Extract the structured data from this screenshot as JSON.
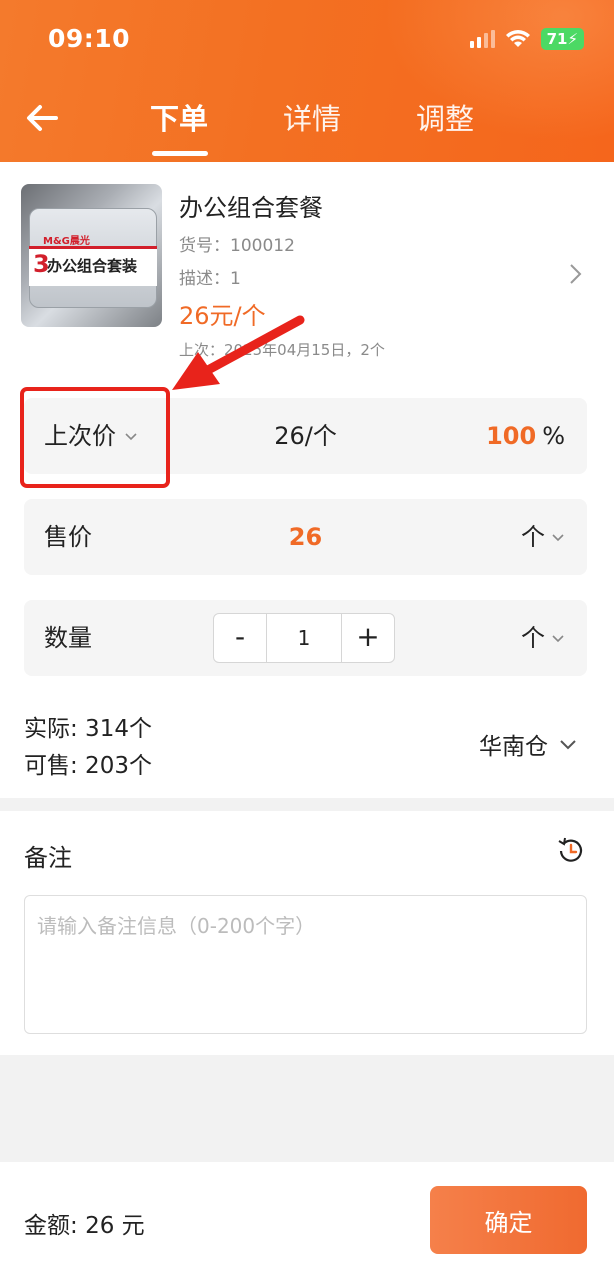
{
  "status_bar": {
    "time": "09:10",
    "battery": "71"
  },
  "header": {
    "tabs": [
      {
        "label": "下单",
        "active": true
      },
      {
        "label": "详情",
        "active": false
      },
      {
        "label": "调整",
        "active": false
      }
    ]
  },
  "product": {
    "image_text": {
      "number": "3",
      "name": "办公组合套装",
      "brand": "M&G晨光"
    },
    "title": "办公组合套餐",
    "item_no": "货号：100012",
    "description": "描述：1",
    "price": "26元/个",
    "last_order": "上次：2025年04月15日，2个"
  },
  "price_row": {
    "label": "上次价",
    "value": "26/个",
    "percent": "100",
    "percent_unit": "%"
  },
  "sale_row": {
    "label": "售价",
    "value": "26",
    "unit": "个"
  },
  "quantity_row": {
    "label": "数量",
    "minus": "-",
    "value": "1",
    "plus": "+",
    "unit": "个"
  },
  "stock": {
    "actual": "实际: 314个",
    "available": "可售: 203个",
    "warehouse": "华南仓"
  },
  "remark": {
    "title": "备注",
    "placeholder": "请输入备注信息（0-200个字）",
    "value": ""
  },
  "footer": {
    "total_label": "金额:",
    "total_value": "26 元",
    "confirm": "确定"
  },
  "colors": {
    "accent": "#f37022",
    "annotation": "#e8231b",
    "price": "#f06a26"
  }
}
